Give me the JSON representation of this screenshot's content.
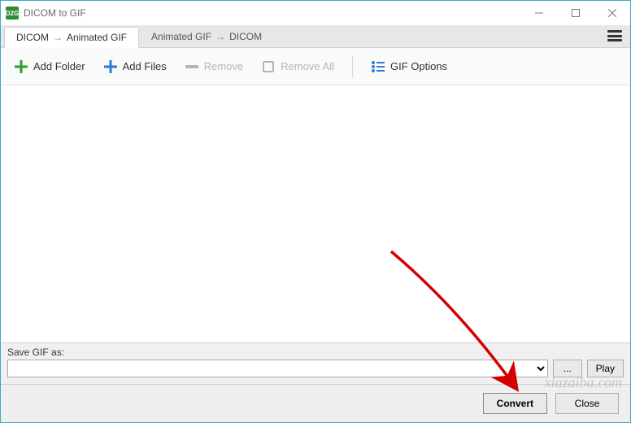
{
  "titlebar": {
    "app_icon_text": "D2G",
    "title": "DICOM to GIF"
  },
  "tabs": {
    "tab1_from": "DICOM",
    "tab1_to": "Animated GIF",
    "tab2_from": "Animated GIF",
    "tab2_to": "DICOM"
  },
  "toolbar": {
    "add_folder": "Add Folder",
    "add_files": "Add Files",
    "remove": "Remove",
    "remove_all": "Remove All",
    "gif_options": "GIF Options"
  },
  "save": {
    "label": "Save GIF as:",
    "path": "",
    "browse": "...",
    "play": "Play"
  },
  "footer": {
    "convert": "Convert",
    "close": "Close"
  },
  "watermark": "xiazaiba.com"
}
